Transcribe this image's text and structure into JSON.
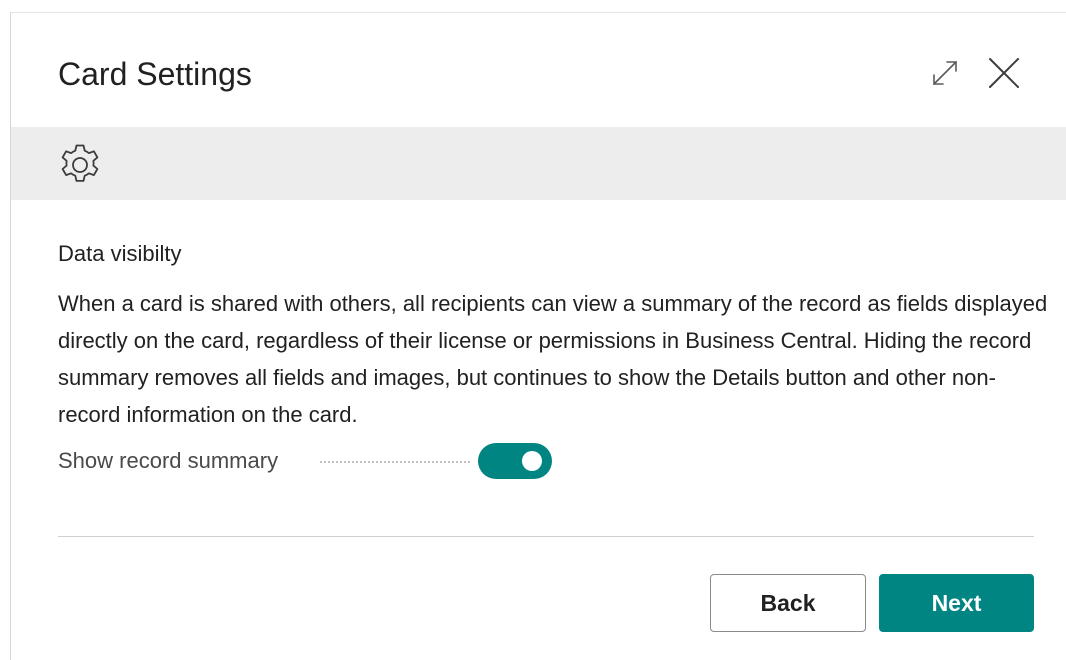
{
  "dialog": {
    "title": "Card Settings",
    "icons": {
      "expand": "expand-icon",
      "close": "close-icon",
      "settings": "gear-icon"
    }
  },
  "section": {
    "heading": "Data visibilty",
    "description": "When a card is shared with others, all recipients can view a summary of the record as fields displayed directly on the card, regardless of their license or permissions in Business Central. Hiding the record summary removes all fields and images, but continues to show the Details button and other non-record information on the card."
  },
  "toggle": {
    "label": "Show record summary",
    "checked": true
  },
  "footer": {
    "back_label": "Back",
    "next_label": "Next"
  },
  "colors": {
    "accent": "#008583",
    "band": "#ededed"
  }
}
